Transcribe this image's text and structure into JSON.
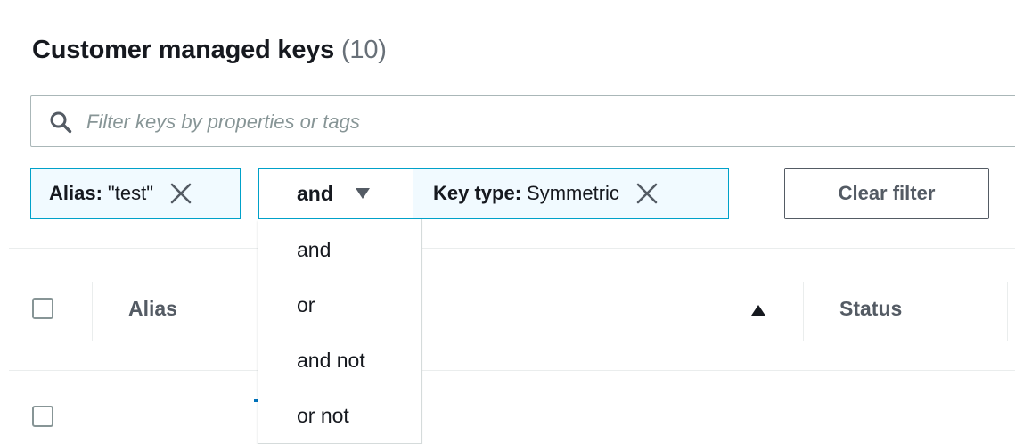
{
  "header": {
    "title": "Customer managed keys",
    "count": "(10)"
  },
  "search": {
    "placeholder": "Filter keys by properties or tags",
    "value": ""
  },
  "filters": {
    "tokens": [
      {
        "key": "Alias:",
        "value": "\"test\""
      },
      {
        "key": "Key type:",
        "value": "Symmetric"
      }
    ],
    "operator": {
      "selected": "and",
      "options": [
        "and",
        "or",
        "and not",
        "or not"
      ]
    },
    "clear_label": "Clear filter"
  },
  "table": {
    "columns": [
      "Alias",
      "Status"
    ],
    "sort_column": "hidden-by-dropdown",
    "sort_direction": "ascending"
  },
  "icons": {
    "search": "search-icon",
    "remove": "close-icon",
    "caret": "caret-down-icon",
    "sort": "sort-ascending-icon"
  },
  "colors": {
    "accent": "#00a1c9",
    "token_bg": "#f1faff",
    "text": "#16191f",
    "muted": "#687078",
    "border": "#aab7b8"
  }
}
